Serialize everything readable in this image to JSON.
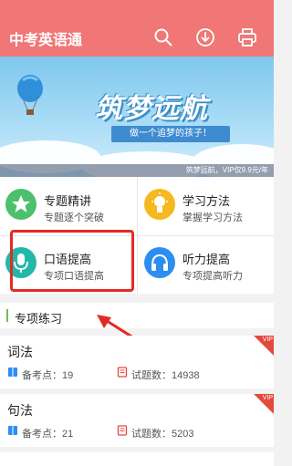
{
  "header": {
    "title": "中考英语通"
  },
  "banner": {
    "slogan": "筑梦远航",
    "ribbon": "做一个追梦的孩子！",
    "footer": "筑梦远航，VIP仅9.9元/年"
  },
  "menu": {
    "items": [
      {
        "label": "专题精讲",
        "sub": "专题逐个突破",
        "color": "#4cc06a"
      },
      {
        "label": "学习方法",
        "sub": "掌握学习方法",
        "color": "#f5b81e"
      },
      {
        "label": "口语提高",
        "sub": "专项口语提高",
        "color": "#22b8a8"
      },
      {
        "label": "听力提高",
        "sub": "专项提高听力",
        "color": "#2c8ef0"
      }
    ]
  },
  "section": {
    "title": "专项练习"
  },
  "cards": [
    {
      "name": "词法",
      "points_label": "备考点：19",
      "questions_label": "试题数：14938",
      "vip": "VIP"
    },
    {
      "name": "句法",
      "points_label": "备考点：21",
      "questions_label": "试题数：5203",
      "vip": "VIP"
    }
  ],
  "colors": {
    "header": "#f07775",
    "highlight": "#e32b25",
    "accent_green": "#6cc04a"
  }
}
